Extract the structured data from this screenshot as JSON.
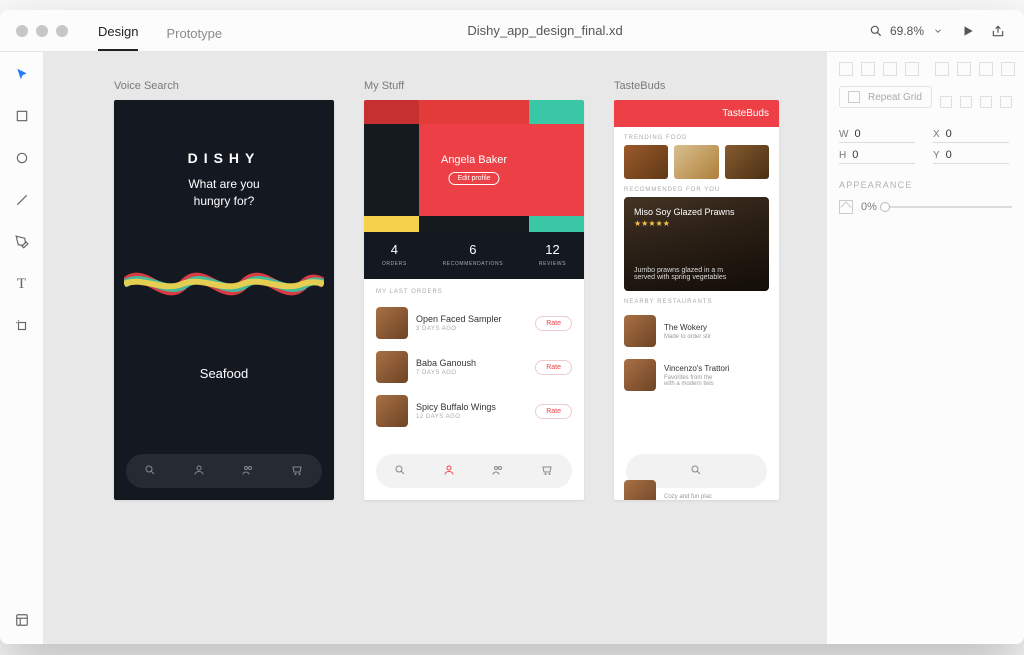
{
  "titlebar": {
    "tabs": [
      "Design",
      "Prototype"
    ],
    "active_tab": 0,
    "file_title": "Dishy_app_design_final.xd",
    "zoom": "69.8%"
  },
  "tools": [
    "select",
    "rectangle",
    "ellipse",
    "line",
    "pen",
    "text",
    "artboard"
  ],
  "artboards": [
    {
      "label": "Voice Search",
      "kind": "voice_search",
      "logo": "DISHY",
      "prompt": "What are you\nhungry for?",
      "result": "Seafood"
    },
    {
      "label": "My Stuff",
      "kind": "my_stuff",
      "user_name": "Angela Baker",
      "edit_label": "Edit profile",
      "stats": [
        {
          "value": "4",
          "label": "ORDERS"
        },
        {
          "value": "6",
          "label": "RECOMMENDATIONS"
        },
        {
          "value": "12",
          "label": "REVIEWS"
        }
      ],
      "orders_header": "MY LAST ORDERS",
      "orders": [
        {
          "name": "Open Faced Sampler",
          "time": "3 DAYS AGO",
          "action": "Rate"
        },
        {
          "name": "Baba Ganoush",
          "time": "7 DAYS AGO",
          "action": "Rate"
        },
        {
          "name": "Spicy Buffalo Wings",
          "time": "12 DAYS AGO",
          "action": "Rate"
        }
      ]
    },
    {
      "label": "TasteBuds",
      "kind": "tastebuds",
      "header": "TasteBuds",
      "sect_trending": "TRENDING FOOD",
      "sect_rec": "RECOMMENDED FOR YOU",
      "hero_title": "Miso Soy Glazed Prawns",
      "hero_desc": "Jumbo prawns glazed in a m\nserved with spring vegetables",
      "sect_nearby": "NEARBY RESTAURANTS",
      "restaurants": [
        {
          "name": "The Wokery",
          "sub": "Made to order stir"
        },
        {
          "name": "Vincenzo's Trattori",
          "sub": "Favorites from the\nwith a modern twis"
        },
        {
          "name": "",
          "sub": "Cozy and fun plac"
        }
      ]
    }
  ],
  "nav_icons": [
    "search-icon",
    "profile-icon",
    "group-icon",
    "cart-icon"
  ],
  "panel": {
    "repeat_grid": "Repeat Grid",
    "dims": {
      "w_label": "W",
      "w_val": "0",
      "x_label": "X",
      "x_val": "0",
      "h_label": "H",
      "h_val": "0",
      "y_label": "Y",
      "y_val": "0"
    },
    "appearance_title": "APPEARANCE",
    "opacity": "0%"
  }
}
